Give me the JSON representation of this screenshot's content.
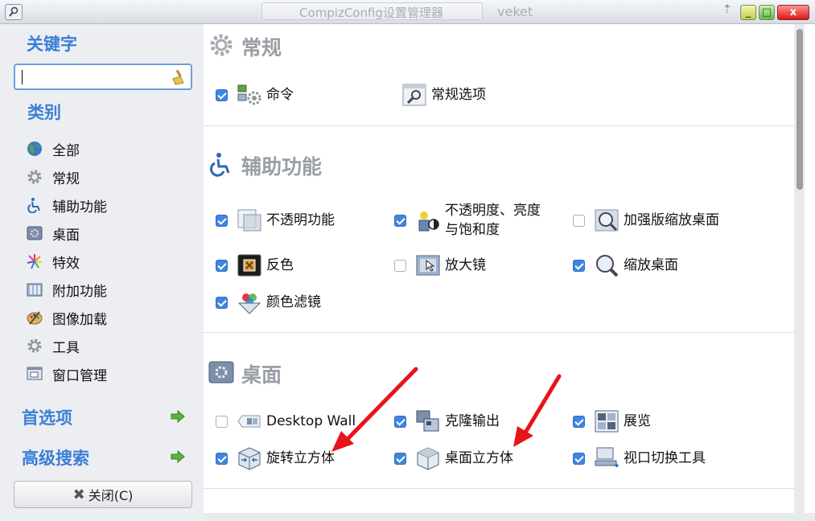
{
  "window": {
    "title": "CompizConfig设置管理器",
    "user": "veket",
    "btn_min": "_",
    "btn_max": "□",
    "btn_close": "x",
    "up_arrow": "⇡"
  },
  "sidebar": {
    "keyword_heading": "关键字",
    "search_value": "",
    "category_heading": "类别",
    "categories": [
      {
        "label": "全部",
        "icon": "globe-icon"
      },
      {
        "label": "常规",
        "icon": "gear-icon"
      },
      {
        "label": "辅助功能",
        "icon": "accessibility-icon"
      },
      {
        "label": "桌面",
        "icon": "desktop-icon"
      },
      {
        "label": "特效",
        "icon": "effects-icon"
      },
      {
        "label": "附加功能",
        "icon": "extras-icon"
      },
      {
        "label": "图像加载",
        "icon": "image-loading-icon"
      },
      {
        "label": "工具",
        "icon": "gear-icon"
      },
      {
        "label": "窗口管理",
        "icon": "window-management-icon"
      }
    ],
    "preferences": "首选项",
    "advanced_search": "高级搜索",
    "close_button": "关闭(C)"
  },
  "groups": [
    {
      "title": "常规",
      "items": [
        {
          "label": "命令",
          "checked": true
        },
        {
          "label": "常规选项",
          "checked": null
        }
      ]
    },
    {
      "title": "辅助功能",
      "items": [
        {
          "label": "不透明功能",
          "checked": true
        },
        {
          "label_line1": "不透明度、亮度",
          "label_line2": "与饱和度",
          "checked": true
        },
        {
          "label": "加强版缩放桌面",
          "checked": false
        },
        {
          "label": "反色",
          "checked": true
        },
        {
          "label": "放大镜",
          "checked": false
        },
        {
          "label": "缩放桌面",
          "checked": true
        },
        {
          "label": "颜色滤镜",
          "checked": true
        }
      ]
    },
    {
      "title": "桌面",
      "items": [
        {
          "label": "Desktop Wall",
          "checked": false
        },
        {
          "label": "克隆输出",
          "checked": true
        },
        {
          "label": "展览",
          "checked": true
        },
        {
          "label": "旋转立方体",
          "checked": true
        },
        {
          "label": "桌面立方体",
          "checked": true
        },
        {
          "label": "视口切换工具",
          "checked": true
        }
      ]
    }
  ],
  "colors": {
    "accent": "#3b7fd6",
    "checkbox": "#3f86dd",
    "annotation_arrow": "#e8141a",
    "group_title": "#9a9ea6"
  }
}
